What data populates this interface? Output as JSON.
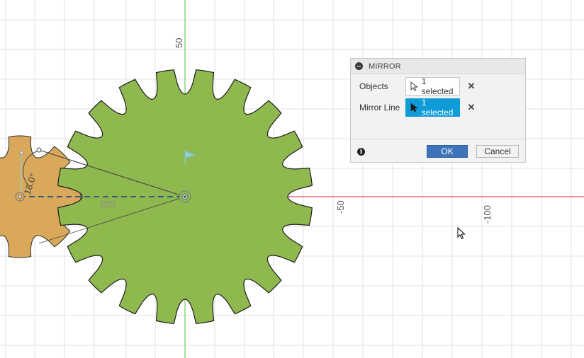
{
  "axes": {
    "y_label_top": "50",
    "x_label_neg50": "-50",
    "x_label_neg100": "-100",
    "angle_dimension": "18.0°"
  },
  "colors": {
    "gear_large": "#8fb84f",
    "gear_small": "#d9a85a",
    "axis_x": "#e05252",
    "axis_y": "#6ccf5f",
    "grid": "#e2e2e2",
    "accent": "#0e9bd8"
  },
  "dialog": {
    "title": "MIRROR",
    "objects_label": "Objects",
    "objects_value": "1 selected",
    "mirror_line_label": "Mirror Line",
    "mirror_line_value": "1 selected",
    "ok_label": "OK",
    "cancel_label": "Cancel"
  },
  "icons": {
    "collapse": "minus-circle-icon",
    "select_cursor": "arrow-cursor-icon",
    "clear": "close-icon",
    "info": "info-icon"
  }
}
